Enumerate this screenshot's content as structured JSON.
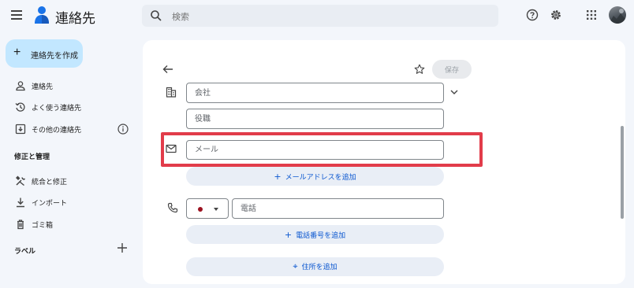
{
  "header": {
    "app_title": "連絡先",
    "search_placeholder": "検索"
  },
  "sidebar": {
    "create_label": "連絡先を作成",
    "items": [
      {
        "label": "連絡先",
        "icon": "person-icon"
      },
      {
        "label": "よく使う連絡先",
        "icon": "history-icon"
      },
      {
        "label": "その他の連絡先",
        "icon": "inbox-download-icon"
      }
    ],
    "section_manage": "修正と管理",
    "manage_items": [
      {
        "label": "統合と修正",
        "icon": "tools-icon"
      },
      {
        "label": "インポート",
        "icon": "download-icon"
      },
      {
        "label": "ゴミ箱",
        "icon": "trash-icon"
      }
    ],
    "section_labels": "ラベル"
  },
  "form": {
    "save_label": "保存",
    "company_placeholder": "会社",
    "title_placeholder": "役職",
    "email_placeholder": "メール",
    "add_email_label": "メールアドレスを追加",
    "phone_placeholder": "電話",
    "add_phone_label": "電話番号を追加",
    "add_address_label": "住所を追加"
  },
  "colors": {
    "accent": "#0b57d0",
    "create_button_bg": "#c2e7ff",
    "highlight_border": "#e23c4a",
    "flag_dot": "#9c1220"
  }
}
